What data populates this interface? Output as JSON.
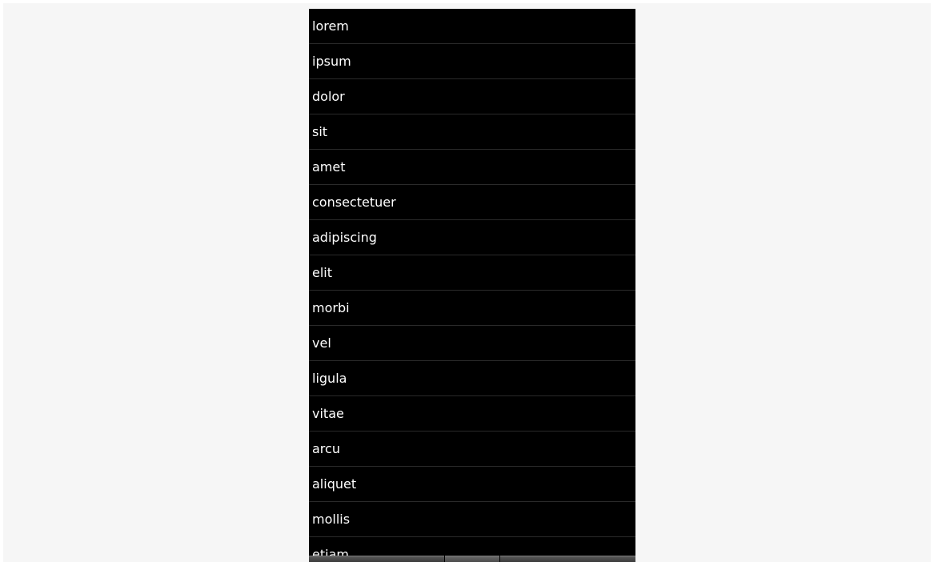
{
  "list": {
    "items": [
      {
        "label": "lorem"
      },
      {
        "label": "ipsum"
      },
      {
        "label": "dolor"
      },
      {
        "label": "sit"
      },
      {
        "label": "amet"
      },
      {
        "label": "consectetuer"
      },
      {
        "label": "adipiscing"
      },
      {
        "label": "elit"
      },
      {
        "label": "morbi"
      },
      {
        "label": "vel"
      },
      {
        "label": "ligula"
      },
      {
        "label": "vitae"
      },
      {
        "label": "arcu"
      },
      {
        "label": "aliquet"
      },
      {
        "label": "mollis"
      },
      {
        "label": "etiam"
      }
    ]
  },
  "bottom_bar": {
    "expand_icon": "chevron-up-icon"
  },
  "colors": {
    "background": "#f6f6f6",
    "list_background": "#000000",
    "text": "#ffffff",
    "divider": "#2a2a2a"
  }
}
